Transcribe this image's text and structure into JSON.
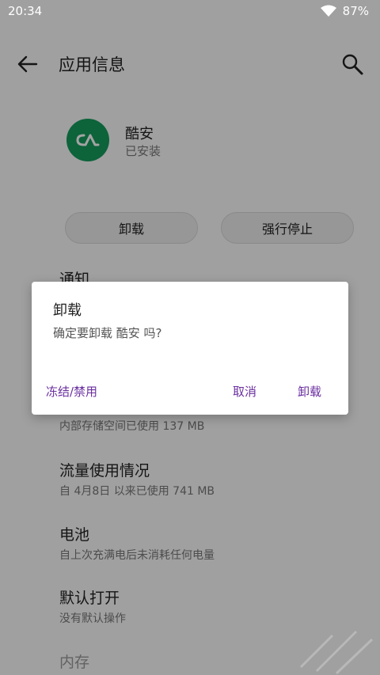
{
  "status_bar": {
    "time": "20:34",
    "battery": "87%"
  },
  "app_bar": {
    "title": "应用信息"
  },
  "app": {
    "name": "酷安",
    "status": "已安装"
  },
  "actions": {
    "uninstall": "卸载",
    "force_stop": "强行停止"
  },
  "sections": [
    {
      "title": "通知",
      "subtitle": ""
    },
    {
      "title": "",
      "subtitle": "内部存储空间已使用 137 MB"
    },
    {
      "title": "流量使用情况",
      "subtitle": "自 4月8日 以来已使用 741 MB"
    },
    {
      "title": "电池",
      "subtitle": "自上次充满电后未消耗任何电量"
    },
    {
      "title": "默认打开",
      "subtitle": "没有默认操作"
    },
    {
      "title": "内存",
      "subtitle": ""
    }
  ],
  "dialog": {
    "title": "卸载",
    "message": "确定要卸载 酷安 吗?",
    "btn_freeze": "冻结/禁用",
    "btn_cancel": "取消",
    "btn_uninstall": "卸载"
  },
  "colors": {
    "accent": "#6a2fa0",
    "app_icon": "#159b5b",
    "scrim": "rgba(0,0,0,0.36)"
  }
}
